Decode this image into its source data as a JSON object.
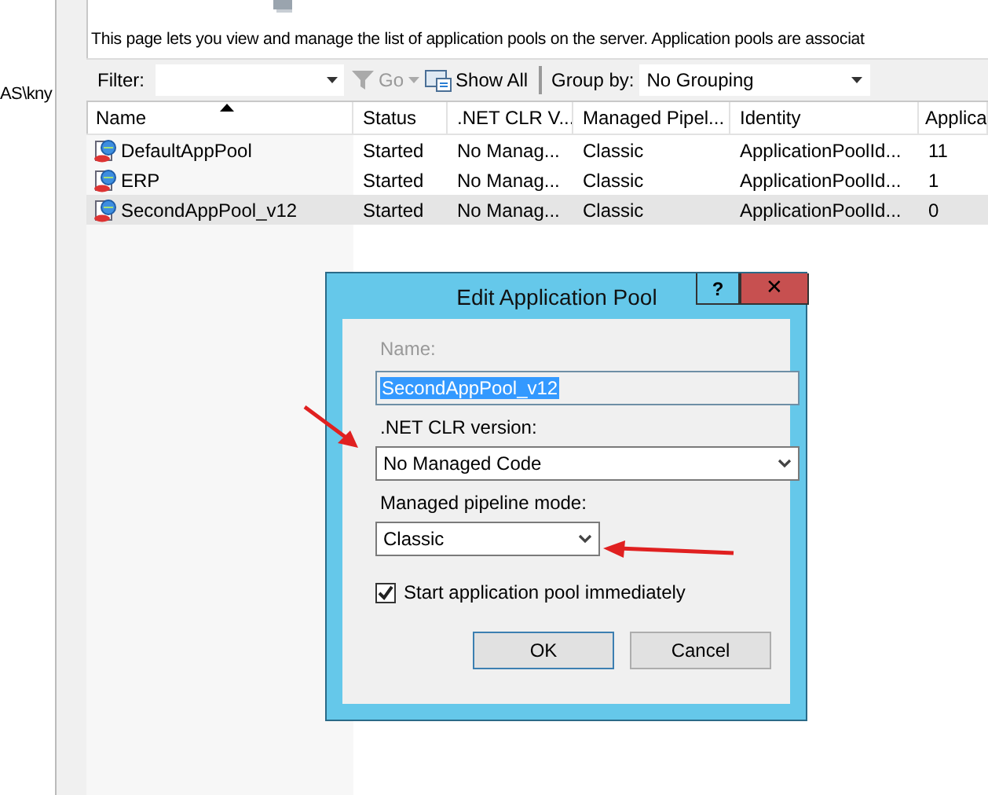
{
  "left_pane": {
    "text": "AS\\kny"
  },
  "description": "This page lets you view and manage the list of application pools on the server. Application pools are associat",
  "toolbar": {
    "filter_label": "Filter:",
    "go": "Go",
    "show_all": "Show All",
    "group_by_label": "Group by:",
    "group_by_value": "No Grouping"
  },
  "table": {
    "columns": [
      {
        "label": "Name",
        "sorted": true
      },
      {
        "label": "Status",
        "sorted": false
      },
      {
        "label": ".NET CLR V...",
        "sorted": false
      },
      {
        "label": "Managed Pipel...",
        "sorted": false
      },
      {
        "label": "Identity",
        "sorted": false
      },
      {
        "label": "Applica",
        "sorted": false
      }
    ],
    "rows": [
      {
        "selected": false,
        "cells": [
          "DefaultAppPool",
          "Started",
          "No Manag...",
          "Classic",
          "ApplicationPoolId...",
          "11"
        ]
      },
      {
        "selected": false,
        "cells": [
          "ERP",
          "Started",
          "No Manag...",
          "Classic",
          "ApplicationPoolId...",
          "1"
        ]
      },
      {
        "selected": true,
        "cells": [
          "SecondAppPool_v12",
          "Started",
          "No Manag...",
          "Classic",
          "ApplicationPoolId...",
          "0"
        ]
      }
    ]
  },
  "dialog": {
    "title": "Edit Application Pool",
    "help": "?",
    "close": "✕",
    "name_label": "Name:",
    "name_disabled": true,
    "name_value": "SecondAppPool_v12",
    "clr_label": ".NET CLR version:",
    "clr_value": "No Managed Code",
    "pipeline_label": "Managed pipeline mode:",
    "pipeline_value": "Classic",
    "start_checkbox": {
      "label": "Start application pool immediately",
      "checked": true
    },
    "buttons": [
      "OK",
      "Cancel"
    ]
  }
}
